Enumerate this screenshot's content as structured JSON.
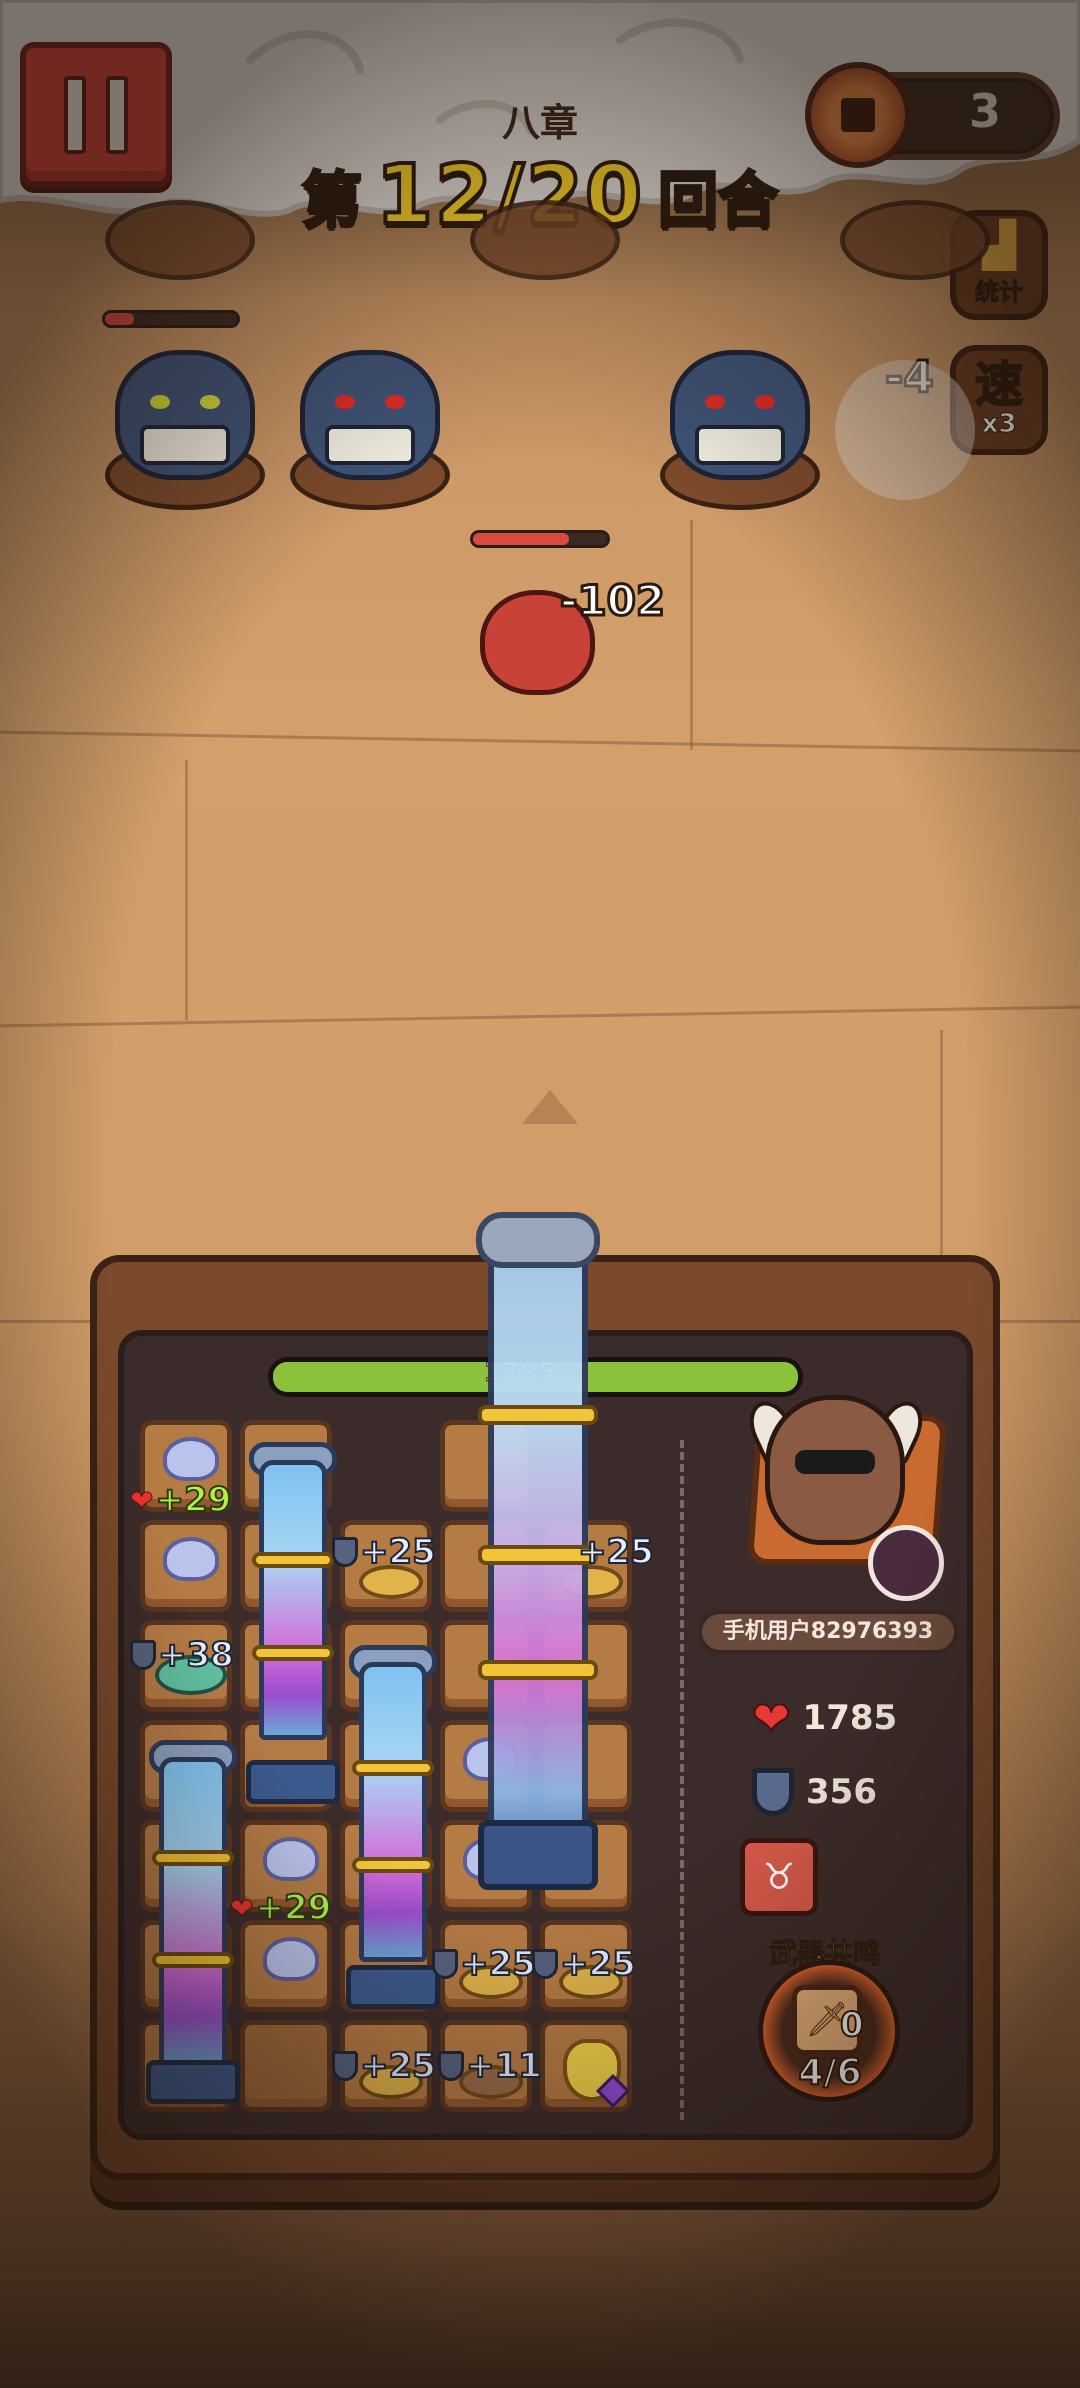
{
  "header": {
    "chapter": "八章",
    "round_prefix": "第",
    "round_current": "12/20",
    "round_suffix": "回合",
    "coins": "3"
  },
  "side_buttons": {
    "stats_label": "统计",
    "speed_label": "速",
    "speed_multiplier": "x3"
  },
  "combat": {
    "damage_popup": "-102",
    "side_damage_popup": "-4",
    "boss_hp_fraction": 0.72
  },
  "board": {
    "hp_fraction": 1.0,
    "hp_text": "1785",
    "badges": {
      "heal_1": "+29",
      "heal_2": "+29",
      "shield_25a": "+25",
      "shield_25b": "+25",
      "shield_38": "+38",
      "shield_25c": "+25",
      "shield_25d": "+25",
      "shield_25e": "+25",
      "shield_11": "+11"
    }
  },
  "player": {
    "name": "手机用户82976393",
    "hp": "1785",
    "armor": "356",
    "resonance_title": "武器共鸣",
    "resonance_count": "0",
    "resonance_progress": "4/6"
  },
  "colors": {
    "hp_green": "#8ac23b",
    "enemy_hp_red": "#d94a43",
    "round_yellow": "#ffd829"
  }
}
